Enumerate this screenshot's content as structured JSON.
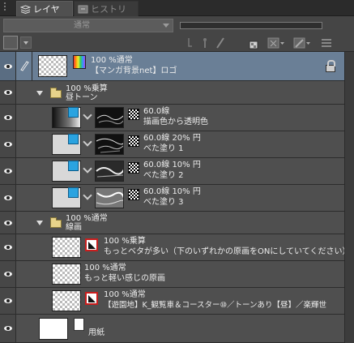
{
  "tabs": {
    "layer": "レイヤー",
    "history": "ヒストリー"
  },
  "toolbar": {
    "blend_mode": "通常"
  },
  "layers": [
    {
      "line1": "100 %通常",
      "line2": "【マンガ背景net】ロゴ"
    },
    {
      "line1": "100 %乗算",
      "line2": "昼トーン"
    },
    {
      "line1": "60.0線",
      "line2": "描画色から透明色"
    },
    {
      "line1": "60.0線 20% 円",
      "line2": "べた塗り 1"
    },
    {
      "line1": "60.0線 10% 円",
      "line2": "べた塗り 2"
    },
    {
      "line1": "60.0線 10% 円",
      "line2": "べた塗り 3"
    },
    {
      "line1": "100 %通常",
      "line2": "線画"
    },
    {
      "line1": "100 %乗算",
      "line2": "もっとベタが多い（下のいずれかの原画をONにしていてください）"
    },
    {
      "line1": "100 %通常",
      "line2": "もっと軽い感じの原画"
    },
    {
      "line1": "100 %通常",
      "line2": "【遊園地】K_観覧車＆コースター⑩／トーンあり【昼】／楽輝世"
    },
    {
      "line1": "",
      "line2": "用紙"
    }
  ]
}
